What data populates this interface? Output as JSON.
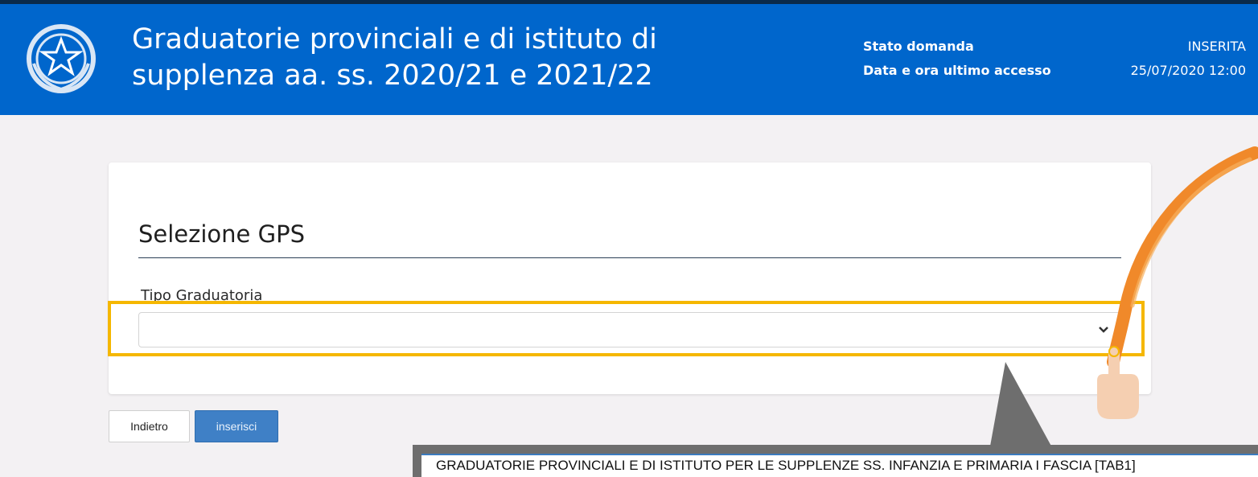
{
  "header": {
    "title": "Graduatorie provinciali e di istituto di supplenza aa. ss. 2020/21 e 2021/22",
    "status_label": "Stato domanda",
    "status_value": "INSERITA",
    "last_access_label": "Data e ora ultimo accesso",
    "last_access_value": "25/07/2020 12:00",
    "bg_color": "#0066cc"
  },
  "card": {
    "title": "Selezione GPS",
    "field_label": "Tipo Graduatoria",
    "select_value": "",
    "select_icon": "chevron-down-icon"
  },
  "buttons": {
    "back_label": "Indietro",
    "insert_label": "inserisci"
  },
  "callout": {
    "text": "GRADUATORIE PROVINCIALI E DI ISTITUTO PER LE SUPPLENZE SS. INFANZIA E PRIMARIA I FASCIA [TAB1]"
  },
  "annotations": {
    "highlight_color": "#f5b700",
    "arrow_color": "#f0892a"
  }
}
